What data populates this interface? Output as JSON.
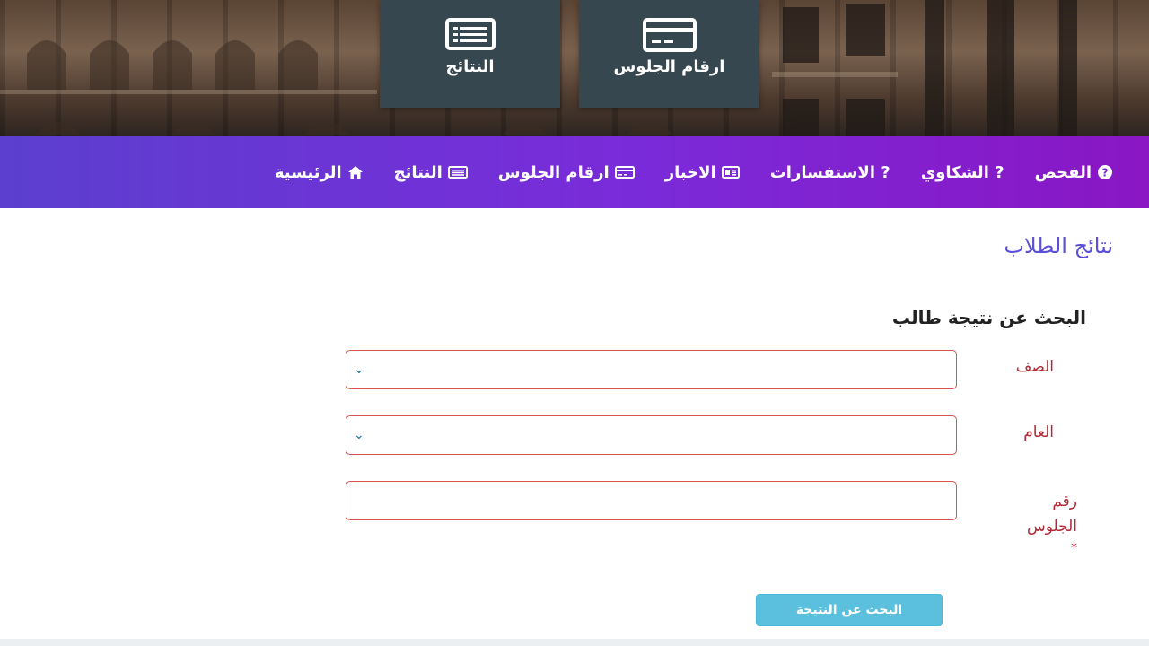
{
  "hero": {
    "tiles": [
      {
        "label": "ارقام الجلوس",
        "icon": "id-card-icon"
      },
      {
        "label": "النتائج",
        "icon": "list-icon"
      }
    ]
  },
  "nav": {
    "items": [
      {
        "label": "الفحص",
        "icon": "question-circle-icon"
      },
      {
        "label": "? الشكاوي",
        "icon": ""
      },
      {
        "label": "? الاستفسارات",
        "icon": ""
      },
      {
        "label": "الاخبار",
        "icon": "newspaper-icon"
      },
      {
        "label": "ارقام الجلوس",
        "icon": "id-card-icon"
      },
      {
        "label": "النتائج",
        "icon": "list-icon"
      },
      {
        "label": "الرئيسية",
        "icon": "home-icon"
      }
    ]
  },
  "page": {
    "title": "نتائج الطلاب",
    "section_title": "البحث عن نتيجة طالب"
  },
  "form": {
    "class_label": "الصف",
    "year_label": "العام",
    "seat_label_line1": "رقم",
    "seat_label_line2": "الجلوس",
    "required_marker": "*",
    "class_value": "",
    "year_value": "",
    "seat_value": "",
    "submit_label": "البحث عن النتيجة"
  },
  "colors": {
    "nav_gradient_start": "#5b3fcf",
    "nav_gradient_end": "#8a16c4",
    "tile_bg": "#37474f",
    "title_color": "#5a4fd6",
    "label_color": "#b02a37",
    "field_border": "#d9534f",
    "button_bg": "#5bc0de"
  }
}
